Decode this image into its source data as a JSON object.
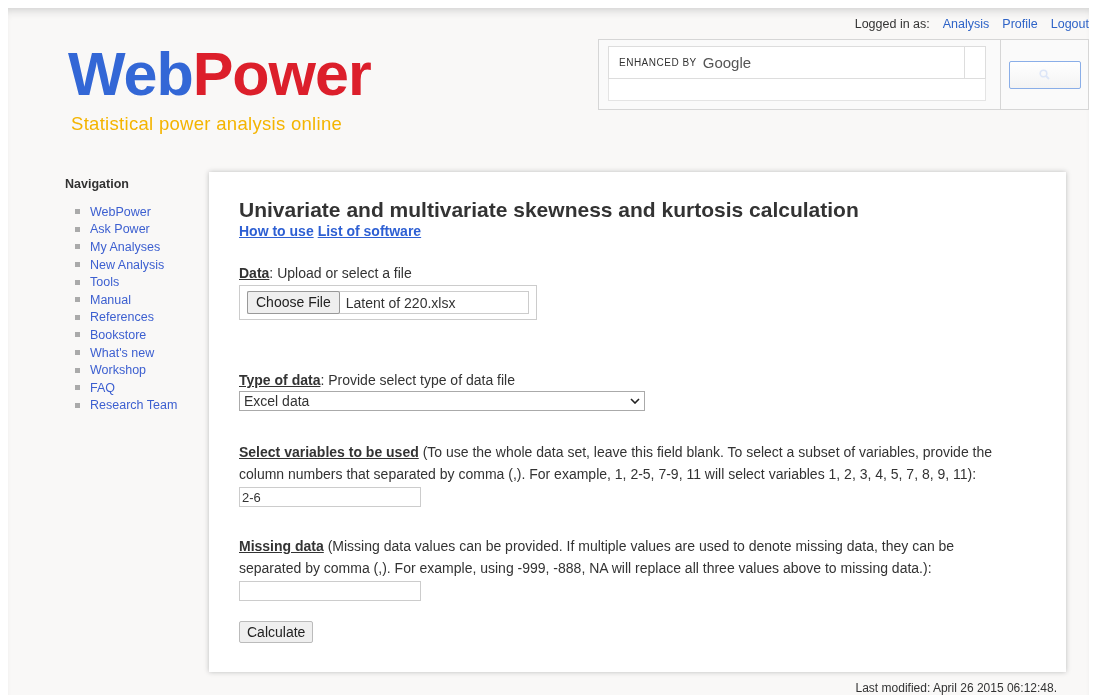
{
  "header": {
    "logo": [
      "Web",
      "Power"
    ],
    "tagline": "Statistical power analysis online",
    "login_label": "Logged in as:",
    "user_links": [
      "Analysis",
      "Profile",
      "Logout"
    ],
    "search": {
      "enhanced_by": "ENHANCED BY",
      "provider": "Google"
    }
  },
  "navigation": {
    "title": "Navigation",
    "items": [
      "WebPower",
      "Ask Power",
      "My Analyses",
      "New Analysis",
      "Tools",
      "Manual",
      "References",
      "Bookstore",
      "What's new",
      "Workshop",
      "FAQ",
      "Research Team"
    ]
  },
  "main": {
    "title": "Univariate and multivariate skewness and kurtosis calculation",
    "links": [
      "How to use",
      "List of software"
    ],
    "fields": [
      {
        "kind": "file",
        "label": "**Data**: Upload or select a file",
        "button": "Choose File",
        "value": "Latent of 220.xlsx"
      },
      {
        "kind": "select",
        "label": "**Type of data**: Provide select type of data file",
        "value": "Excel data"
      },
      {
        "kind": "text",
        "label": "**Select variables to be used** (To use the whole data set, leave this field blank. To select a subset of variables, provide the column numbers that separated by comma (,). For example, 1, 2-5, 7-9, 11 will select variables 1, 2, 3, 4, 5, 7, 8, 9, 11):",
        "value": "2-6"
      },
      {
        "kind": "text",
        "label": "**Missing data** (Missing data values can be provided. If multiple values are used to denote missing data, they can be separated by comma (,). For example, using -999, -888, NA will replace all three values above to missing data.):"
      }
    ],
    "submit": "Calculate"
  },
  "footer": "Last modified: April 26 2015 06:12:48."
}
